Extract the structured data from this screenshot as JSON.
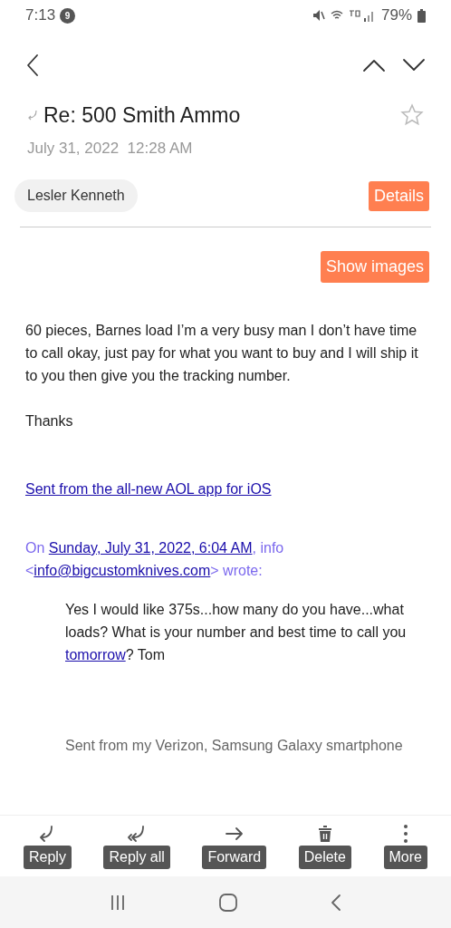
{
  "status_bar": {
    "time": "7:13",
    "notification_count": "9",
    "battery": "79%"
  },
  "message": {
    "subject": "Re: 500 Smith Ammo",
    "replied": true,
    "starred": false,
    "date": "July 31, 2022  12:28 AM",
    "sender": "Lesler Kenneth",
    "details_button": "Details",
    "show_images_button": "Show images"
  },
  "body": {
    "paragraph": "60 pieces, Barnes load I’m a very busy man I don’t have time to call okay, just pay for what you want to buy and I will ship it to you then give you the tracking number.",
    "closing": "Thanks",
    "signature_link": "Sent from the all-new AOL app for iOS",
    "quote_header": [
      {
        "kind": "text",
        "text": "On "
      },
      {
        "kind": "link",
        "text": "Sunday, July 31, 2022, 6:04 AM"
      },
      {
        "kind": "text",
        "text": ", info <"
      },
      {
        "kind": "link",
        "text": "info@bigcustomknives.com"
      },
      {
        "kind": "text",
        "text": "> wrote:"
      }
    ],
    "quoted": [
      {
        "kind": "text",
        "text": "Yes I would like 375s...how many do you have...what loads? What is your number and best time to call you "
      },
      {
        "kind": "link",
        "text": "tomorrow"
      },
      {
        "kind": "text",
        "text": "? Tom"
      }
    ],
    "quoted_signature": "Sent from my Verizon, Samsung Galaxy smartphone"
  },
  "actions": [
    {
      "kind": "reply",
      "label": "Reply"
    },
    {
      "kind": "reply_all",
      "label": "Reply all"
    },
    {
      "kind": "forward",
      "label": "Forward"
    },
    {
      "kind": "delete",
      "label": "Delete"
    },
    {
      "kind": "more",
      "label": "More"
    }
  ]
}
